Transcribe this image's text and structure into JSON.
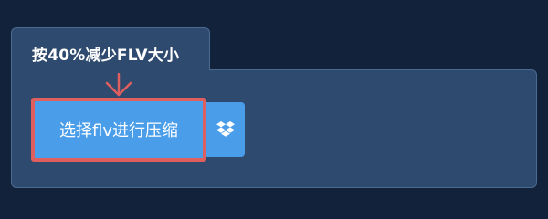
{
  "tab": {
    "label": "按40%减少FLV大小"
  },
  "actions": {
    "compress_label": "选择flv进行压缩",
    "dropbox_icon": "dropbox-icon"
  },
  "annotation": {
    "arrow_icon": "arrow-down-icon"
  },
  "colors": {
    "background": "#12223a",
    "panel": "#2e4a6e",
    "button": "#4a9de9",
    "highlight": "#df5f5f"
  }
}
